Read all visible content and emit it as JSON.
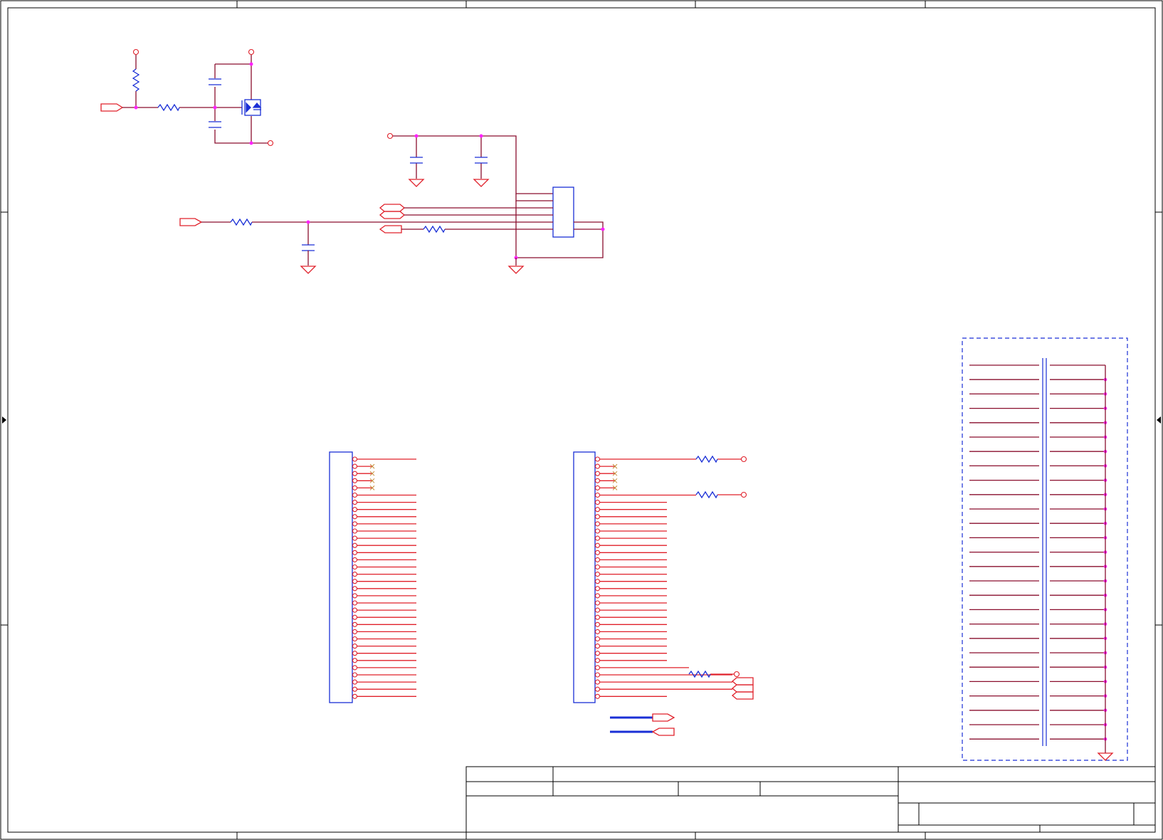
{
  "sheet": {
    "border_color": "#000000",
    "wire_color": "#8a0f2e",
    "symbol_color": "#e0202a",
    "component_color": "#1a2fd6",
    "junction_color": "#ff22ff"
  },
  "title_block": {
    "rows": 4
  },
  "icons": [
    "resistor-icon",
    "capacitor-icon",
    "ground-icon",
    "mosfet-icon",
    "port-icon",
    "power-pin-icon",
    "connector-icon",
    "no-connect-icon",
    "bus-icon"
  ],
  "components": {
    "mosfet_group": {
      "resistors": 2,
      "capacitors": 2,
      "mosfet": 1
    },
    "regulator_group": {
      "capacitors": 3,
      "resistors": 2,
      "ic_pins": 6,
      "grounds": 4
    },
    "connector_left": {
      "pins": 34,
      "no_connect": 4
    },
    "connector_right": {
      "pins": 34,
      "no_connect": 4,
      "resistors": 3
    },
    "bus_array": {
      "lines": 27
    },
    "bus_ports": 2
  }
}
